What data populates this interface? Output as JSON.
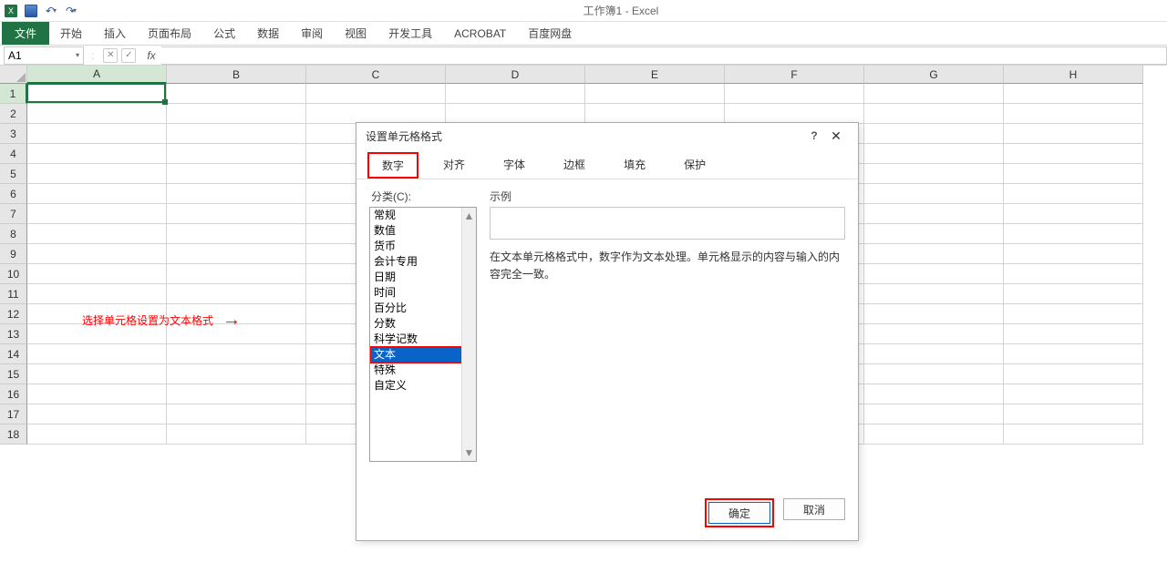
{
  "titlebar": {
    "title": "工作簿1 - Excel"
  },
  "ribbon": {
    "file": "文件",
    "tabs": [
      "开始",
      "插入",
      "页面布局",
      "公式",
      "数据",
      "审阅",
      "视图",
      "开发工具",
      "ACROBAT",
      "百度网盘"
    ]
  },
  "fbar": {
    "cellref": "A1",
    "fx": "fx",
    "cancel_glyph": "✕",
    "confirm_glyph": "✓"
  },
  "grid": {
    "cols": [
      "A",
      "B",
      "C",
      "D",
      "E",
      "F",
      "G",
      "H"
    ],
    "rows": [
      "1",
      "2",
      "3",
      "4",
      "5",
      "6",
      "7",
      "8",
      "9",
      "10",
      "11",
      "12",
      "13",
      "14",
      "15",
      "16",
      "17",
      "18"
    ]
  },
  "annotation": {
    "text": "选择单元格设置为文本格式",
    "arrow": "→"
  },
  "dialog": {
    "title": "设置单元格格式",
    "help": "?",
    "close": "✕",
    "tabs": [
      "数字",
      "对齐",
      "字体",
      "边框",
      "填充",
      "保护"
    ],
    "active_tab": 0,
    "category_label": "分类(C):",
    "categories": [
      "常规",
      "数值",
      "货币",
      "会计专用",
      "日期",
      "时间",
      "百分比",
      "分数",
      "科学记数",
      "文本",
      "特殊",
      "自定义"
    ],
    "selected_category": 9,
    "sample_label": "示例",
    "description": "在文本单元格格式中，数字作为文本处理。单元格显示的内容与输入的内容完全一致。",
    "ok": "确定",
    "cancel": "取消",
    "scroll_up": "▲",
    "scroll_down": "▼"
  }
}
